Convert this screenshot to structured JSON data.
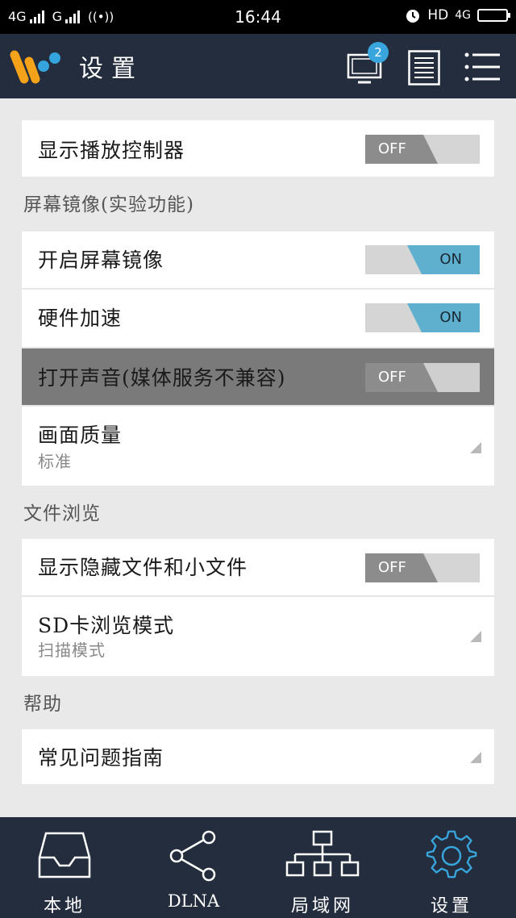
{
  "status_bar": {
    "network1": "4G",
    "network2": "G",
    "time": "16:44",
    "hd": "HD",
    "net_right": "4G"
  },
  "header": {
    "title": "设置",
    "cast_badge": "2"
  },
  "settings": {
    "display_player_controls": {
      "label": "显示播放控制器",
      "state": "OFF"
    },
    "screen_mirroring_section": "屏幕镜像(实验功能)",
    "enable_screen_mirroring": {
      "label": "开启屏幕镜像",
      "state": "ON"
    },
    "hardware_acceleration": {
      "label": "硬件加速",
      "state": "ON"
    },
    "enable_sound": {
      "label": "打开声音(媒体服务不兼容)",
      "state": "OFF"
    },
    "picture_quality": {
      "label": "画面质量",
      "value": "标准"
    },
    "file_browsing_section": "文件浏览",
    "show_hidden_files": {
      "label": "显示隐藏文件和小文件",
      "state": "OFF"
    },
    "sd_browse_mode": {
      "label": "SD卡浏览模式",
      "value": "扫描模式"
    },
    "help_section": "帮助",
    "faq_guide": {
      "label": "常见问题指南"
    }
  },
  "bottom_nav": {
    "local": "本地",
    "dlna": "DLNA",
    "lan": "局域网",
    "settings": "设置"
  },
  "colors": {
    "header_bg": "#232d3d",
    "accent": "#38a6dd",
    "toggle_on": "#5fb0cf",
    "toggle_off": "#8c8c8c",
    "highlight_row": "#7a7a7a"
  }
}
